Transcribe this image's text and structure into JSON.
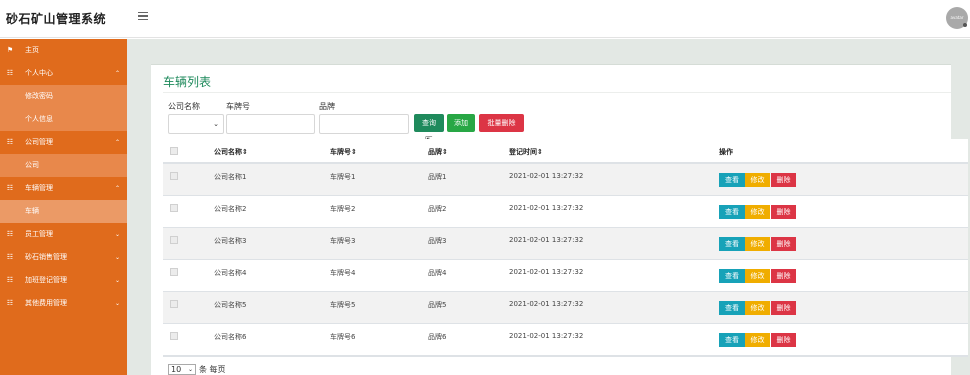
{
  "app": {
    "title": "砂石矿山管理系统",
    "avatar_text": "avatar"
  },
  "sidebar": {
    "items": [
      {
        "label": "主页",
        "icon": "flag-icon"
      },
      {
        "label": "个人中心",
        "icon": "grid-icon",
        "expandable": true
      },
      {
        "label": "修改密码",
        "sub": true
      },
      {
        "label": "个人信息",
        "sub": true
      },
      {
        "label": "公司管理",
        "icon": "grid-icon",
        "expandable": true
      },
      {
        "label": "公司",
        "sub": true
      },
      {
        "label": "车辆管理",
        "icon": "grid-icon",
        "expandable": true
      },
      {
        "label": "车辆",
        "sub": true,
        "active": true
      },
      {
        "label": "员工管理",
        "icon": "grid-icon",
        "expandable": true
      },
      {
        "label": "砂石销售管理",
        "icon": "grid-icon",
        "expandable": true
      },
      {
        "label": "加班登记管理",
        "icon": "grid-icon",
        "expandable": true
      },
      {
        "label": "其他费用管理",
        "icon": "grid-icon",
        "expandable": true
      }
    ]
  },
  "page": {
    "title": "车辆列表"
  },
  "filters": {
    "company_label": "公司名称",
    "plate_label": "车牌号",
    "brand_label": "品牌",
    "company_value": "",
    "plate_value": "",
    "brand_value": ""
  },
  "buttons": {
    "query": "查询",
    "add": "添加",
    "batch_delete": "批量删除"
  },
  "table": {
    "headers": [
      "公司名称",
      "车牌号",
      "品牌",
      "登记时间",
      "操作"
    ],
    "sort_marker": "⇕",
    "rows": [
      {
        "company": "公司名称1",
        "plate": "车牌号1",
        "brand": "品牌1",
        "time": "2021-02-01 13:27:32"
      },
      {
        "company": "公司名称2",
        "plate": "车牌号2",
        "brand": "品牌2",
        "time": "2021-02-01 13:27:32"
      },
      {
        "company": "公司名称3",
        "plate": "车牌号3",
        "brand": "品牌3",
        "time": "2021-02-01 13:27:32"
      },
      {
        "company": "公司名称4",
        "plate": "车牌号4",
        "brand": "品牌4",
        "time": "2021-02-01 13:27:32"
      },
      {
        "company": "公司名称5",
        "plate": "车牌号5",
        "brand": "品牌5",
        "time": "2021-02-01 13:27:32"
      },
      {
        "company": "公司名称6",
        "plate": "车牌号6",
        "brand": "品牌6",
        "time": "2021-02-01 13:27:32"
      }
    ],
    "actions": {
      "view": "查看",
      "edit": "修改",
      "delete": "删除"
    }
  },
  "pagination": {
    "page_size": "10",
    "suffix": "条 每页"
  },
  "colors": {
    "sidebar": "#e06b1c",
    "accent": "#1f8a5c",
    "danger": "#dc3545",
    "warning": "#f0ad00",
    "info": "#17a2b8"
  }
}
